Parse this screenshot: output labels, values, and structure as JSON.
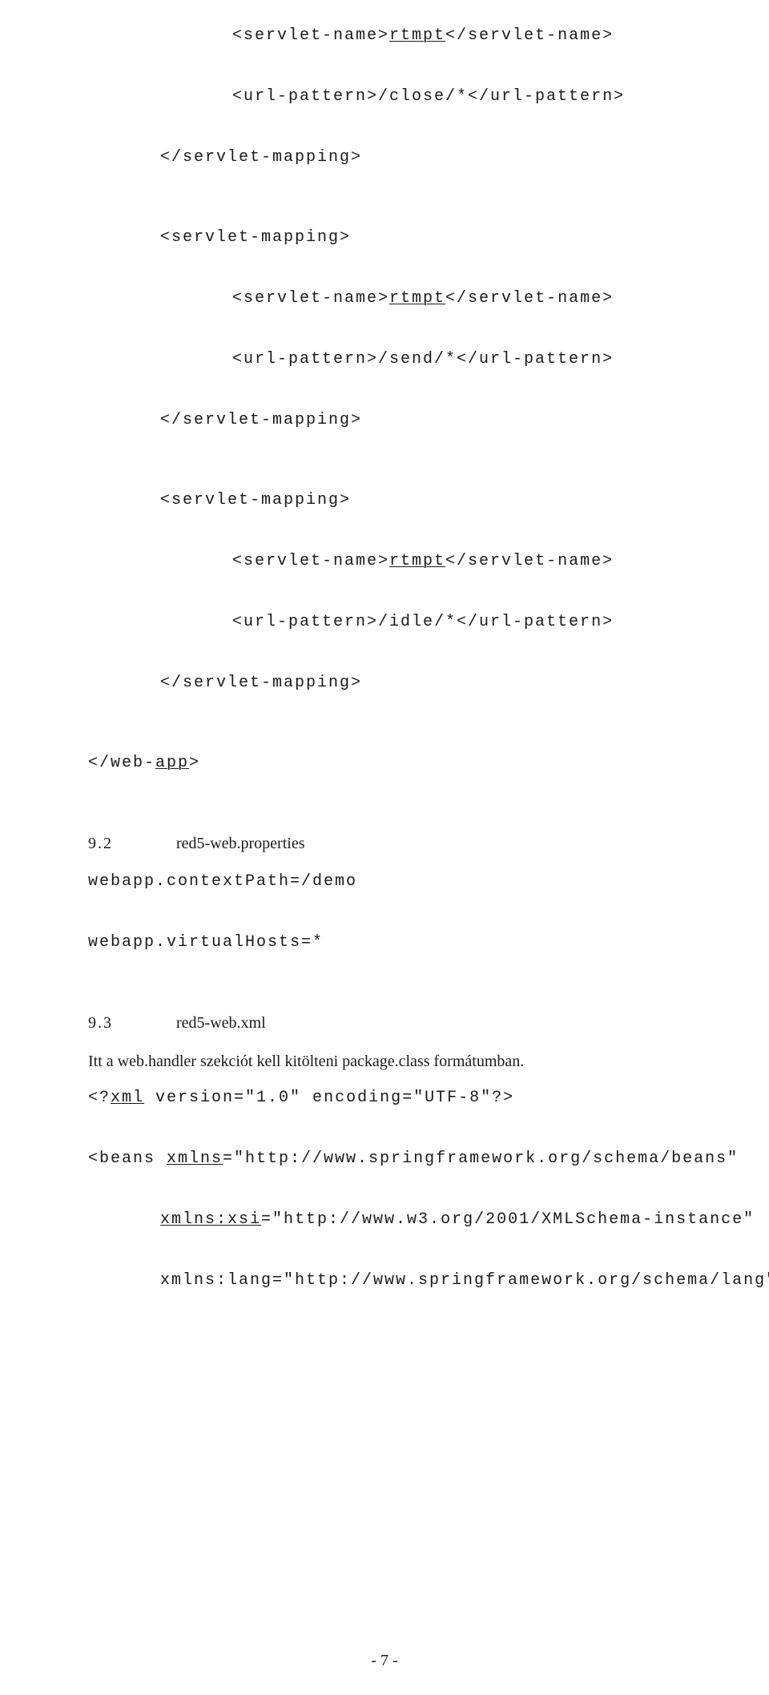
{
  "code": {
    "sm1_name_open": "<servlet-name>",
    "sm1_name_value": "rtmpt",
    "sm1_name_close": "</servlet-name>",
    "sm1_url": "<url-pattern>/close/*</url-pattern>",
    "sm_close": "</servlet-mapping>",
    "sm_open": "<servlet-mapping>",
    "sm2_url": "<url-pattern>/send/*</url-pattern>",
    "sm3_url": "<url-pattern>/idle/*</url-pattern>",
    "webapp_close_open": "</web-",
    "webapp_close_app": "app",
    "webapp_close_end": ">"
  },
  "sec92": {
    "num": "9.2",
    "title": "red5-web.properties",
    "line1": "webapp.contextPath=/demo",
    "line2": "webapp.virtualHosts=*"
  },
  "sec93": {
    "num": "9.3",
    "title": "red5-web.xml",
    "prose": "Itt a web.handler szekciót kell kitölteni package.class formátumban.",
    "xml_open": "<?",
    "xml_tag": "xml",
    "xml_rest": " version=\"1.0\" encoding=\"UTF-8\"?>",
    "beans_open": "<beans ",
    "beans_attr": "xmlns",
    "beans_rest": "=\"http://www.springframework.org/schema/beans\"",
    "xsi_attr": "xmlns:xsi",
    "xsi_rest": "=\"http://www.w3.org/2001/XMLSchema-instance\"",
    "lang_line": "xmlns:lang=\"http://www.springframework.org/schema/lang\""
  },
  "page_number": "- 7 -"
}
